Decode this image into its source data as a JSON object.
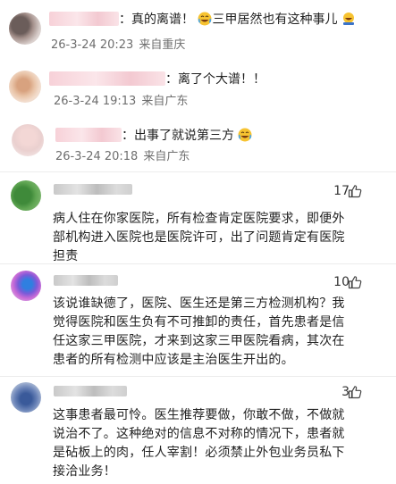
{
  "replies": [
    {
      "text_suffix": "：真的离谱！",
      "text_after": "三甲居然也有这种事儿",
      "date": "26-3-24 20:23",
      "location": "来自重庆",
      "emojis": [
        "laugh-cry-emoji",
        "lol-emoji"
      ]
    },
    {
      "text_suffix": "：离了个大谱！！",
      "date": "26-3-24 19:13",
      "location": "来自广东"
    },
    {
      "text_suffix": "：出事了就说第三方",
      "date": "26-3-24 20:18",
      "location": "来自广东",
      "emojis": [
        "laugh-cry-emoji"
      ]
    }
  ],
  "comments": [
    {
      "likes": "17",
      "lines": [
        "病人住在你家医院，所有检查肯定医院要求，即便外",
        "部机构进入医院也是医院许可，出了问题肯定有医院",
        "担责"
      ]
    },
    {
      "likes": "10",
      "lines": [
        "该说谁缺德了，医院、医生还是第三方检测机构？我",
        "觉得医院和医生负有不可推卸的责任，首先患者是信",
        "任这家三甲医院，才来到这家三甲医院看病，其次在",
        "患者的所有检测中应该是主治医生开出的。"
      ]
    },
    {
      "likes": "3",
      "lines": [
        "这事患者最可怜。医生推荐要做，你敢不做，不做就",
        "说治不了。这种绝对的信息不对称的情况下，患者就",
        "是砧板上的肉，任人宰割！必须禁止外包业务员私下",
        "接洽业务！"
      ]
    }
  ],
  "icons": {
    "like": "thumbs-up-icon"
  },
  "colors": {
    "text": "#222222",
    "meta": "#6e6e6e",
    "name_blur_reply": "#f3c9d1",
    "divider": "#ececec"
  }
}
